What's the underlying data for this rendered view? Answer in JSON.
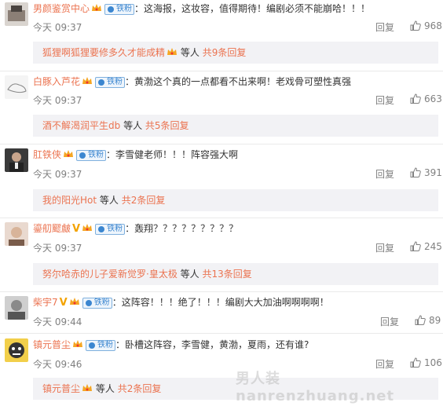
{
  "comments": [
    {
      "username": "男颜鉴赏中心",
      "fan_badge": "铁粉",
      "text": "：这海报，这妆容，值得期待！编剧必须不能崩哈！！！",
      "time": "今天 09:37",
      "reply_label": "回复",
      "likes": "968",
      "sub": {
        "who": "狐狸啊狐狸要修多久才能成精",
        "etc": "等人",
        "count": "共9条回复"
      }
    },
    {
      "username": "白豚入芦花",
      "fan_badge": "铁粉",
      "text": "：黄渤这个真的一点都看不出来啊！老戏骨可塑性真强",
      "time": "今天 09:37",
      "reply_label": "回复",
      "likes": "663",
      "sub": {
        "who": "酒不解渴润平生db",
        "etc": "等人",
        "count": "共5条回复"
      }
    },
    {
      "username": "肛铁侠",
      "fan_badge": "铁粉",
      "text": "：李雪健老师！！！阵容强大啊",
      "time": "今天 09:37",
      "reply_label": "回复",
      "likes": "391",
      "sub": {
        "who": "我的阳光Hot",
        "etc": "等人",
        "count": "共2条回复"
      }
    },
    {
      "username": "鎏舠飂皻",
      "fan_badge": "铁粉",
      "text": "：轰翔？？？？？？？？？",
      "time": "今天 09:37",
      "reply_label": "回复",
      "likes": "245",
      "sub": {
        "who": "努尔哈赤的儿子爱新觉罗·皇太极",
        "etc": "等人",
        "count": "共13条回复"
      }
    },
    {
      "username": "柴宇7",
      "fan_badge": "铁粉",
      "text": "：这阵容！！！绝了！！！编剧大大加油啊啊啊啊！",
      "time": "今天 09:44",
      "reply_label": "回复",
      "likes": "89"
    },
    {
      "username": "镇元普尘",
      "fan_badge": "铁粉",
      "text": "：卧槽这阵容，李雪健，黄渤，夏雨，还有谁?",
      "time": "今天 09:46",
      "reply_label": "回复",
      "likes": "106",
      "sub": {
        "who": "镇元普尘",
        "etc": "等人",
        "count": "共2条回复"
      }
    }
  ],
  "watermark": "男人装 nanrenzhuang.net",
  "colors": {
    "username": "#eb7350",
    "meta": "#808080",
    "fan": "#3b86d0",
    "sub_bg": "#f2f2f5"
  },
  "icons": {
    "like": "thumbs-up-icon",
    "crown": "crown-icon",
    "fan": "fan-badge-icon",
    "verified": "v-verified-icon"
  }
}
